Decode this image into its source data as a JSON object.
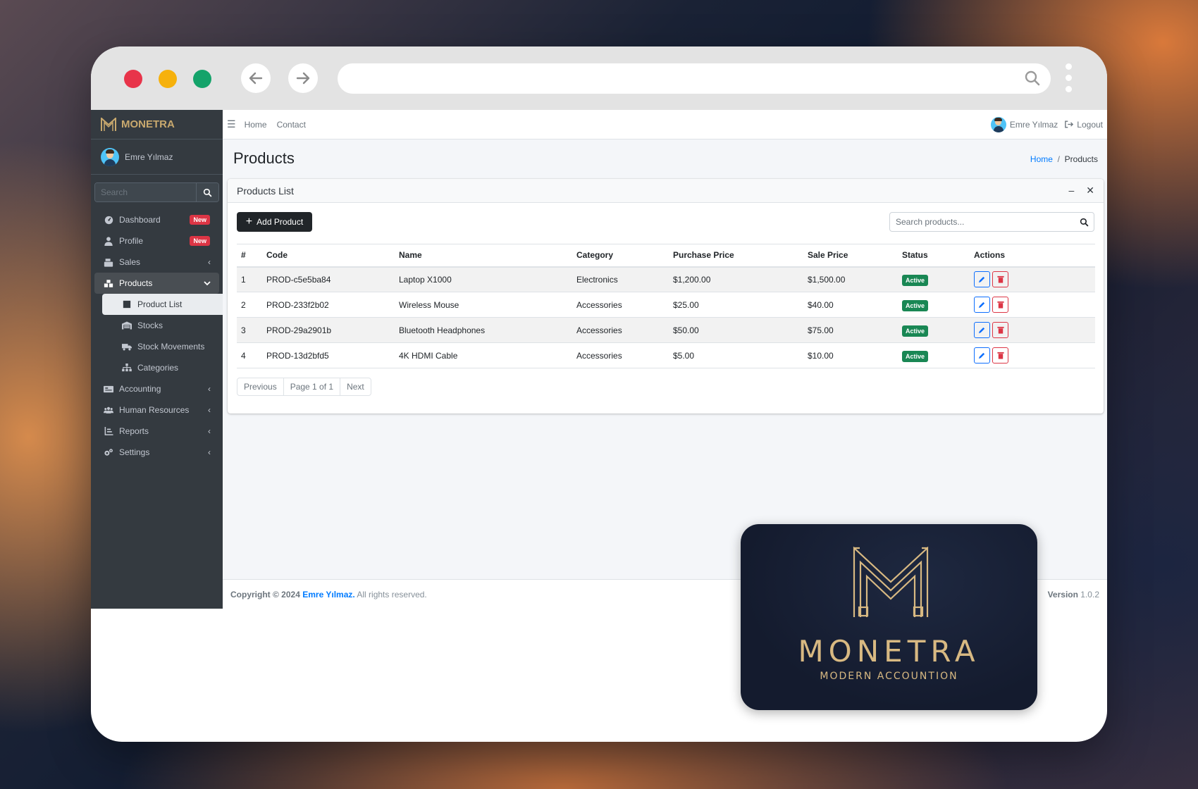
{
  "app": {
    "brand": "MONETRA",
    "user_name": "Emre Yılmaz"
  },
  "sidebar": {
    "search_placeholder": "Search",
    "items": [
      {
        "label": "Dashboard",
        "icon": "dashboard-icon",
        "badge": "New"
      },
      {
        "label": "Profile",
        "icon": "user-icon",
        "badge": "New"
      },
      {
        "label": "Sales",
        "icon": "cash-register-icon"
      },
      {
        "label": "Products",
        "icon": "boxes-icon",
        "expanded": true
      },
      {
        "label": "Product List",
        "icon": "box-icon",
        "active": true
      },
      {
        "label": "Stocks",
        "icon": "warehouse-icon"
      },
      {
        "label": "Stock Movements",
        "icon": "truck-icon"
      },
      {
        "label": "Categories",
        "icon": "sitemap-icon"
      },
      {
        "label": "Accounting",
        "icon": "money-check-icon"
      },
      {
        "label": "Human Resources",
        "icon": "users-icon"
      },
      {
        "label": "Reports",
        "icon": "chart-icon"
      },
      {
        "label": "Settings",
        "icon": "cogs-icon"
      }
    ]
  },
  "topnav": {
    "links": [
      "Home",
      "Contact"
    ],
    "user_name": "Emre Yılmaz",
    "logout": "Logout"
  },
  "page": {
    "title": "Products",
    "breadcrumb_home": "Home",
    "breadcrumb_current": "Products"
  },
  "card": {
    "title": "Products List",
    "add_button": "Add Product",
    "search_placeholder": "Search products..."
  },
  "table": {
    "headers": [
      "#",
      "Code",
      "Name",
      "Category",
      "Purchase Price",
      "Sale Price",
      "Status",
      "Actions"
    ],
    "rows": [
      [
        "1",
        "PROD-c5e5ba84",
        "Laptop X1000",
        "Electronics",
        "$1,200.00",
        "$1,500.00",
        "Active"
      ],
      [
        "2",
        "PROD-233f2b02",
        "Wireless Mouse",
        "Accessories",
        "$25.00",
        "$40.00",
        "Active"
      ],
      [
        "3",
        "PROD-29a2901b",
        "Bluetooth Headphones",
        "Accessories",
        "$50.00",
        "$75.00",
        "Active"
      ],
      [
        "4",
        "PROD-13d2bfd5",
        "4K HDMI Cable",
        "Accessories",
        "$5.00",
        "$10.00",
        "Active"
      ]
    ]
  },
  "pager": {
    "prev": "Previous",
    "info": "Page 1 of 1",
    "next": "Next"
  },
  "footer": {
    "copyright": "Copyright © 2024",
    "owner": "Emre Yılmaz.",
    "rights": "All rights reserved.",
    "version_label": "Version",
    "version": "1.0.2"
  },
  "logo_card": {
    "wordmark": "MONETRA",
    "tagline": "MODERN ACCOUNTION"
  },
  "colors": {
    "sidebar": "#343a40",
    "primary": "#007bff",
    "danger": "#dc3545",
    "success": "#198754",
    "gold": "#d8b982"
  }
}
